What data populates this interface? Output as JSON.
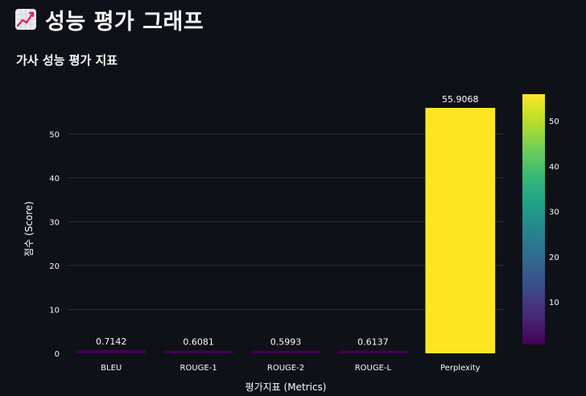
{
  "header": {
    "title": "성능 평가 그래프",
    "icon": "chart-increasing-icon"
  },
  "colors": {
    "background": "#0e1117",
    "text": "#fafafa",
    "grid": "#2b2f38",
    "colorscale": [
      "#440154",
      "#482878",
      "#3e4989",
      "#31688e",
      "#26828e",
      "#1f9e89",
      "#35b779",
      "#6ece58",
      "#b5de2b",
      "#fde725"
    ]
  },
  "chart_data": {
    "type": "bar",
    "title": "가사 성능 평가 지표",
    "xlabel": "평가지표 (Metrics)",
    "ylabel": "점수 (Score)",
    "categories": [
      "BLEU",
      "ROUGE-1",
      "ROUGE-2",
      "ROUGE-L",
      "Perplexity"
    ],
    "values": [
      0.7142,
      0.6081,
      0.5993,
      0.6137,
      55.9068
    ],
    "data_labels": [
      "0.7142",
      "0.6081",
      "0.5993",
      "0.6137",
      "55.9068"
    ],
    "ylim": [
      0,
      58.85
    ],
    "yticks": [
      0,
      10,
      20,
      30,
      40,
      50
    ],
    "grid": true,
    "colorbar": {
      "range": [
        0.5993,
        55.9068
      ],
      "ticks": [
        10,
        20,
        30,
        40,
        50
      ],
      "colormap": "viridis"
    }
  }
}
